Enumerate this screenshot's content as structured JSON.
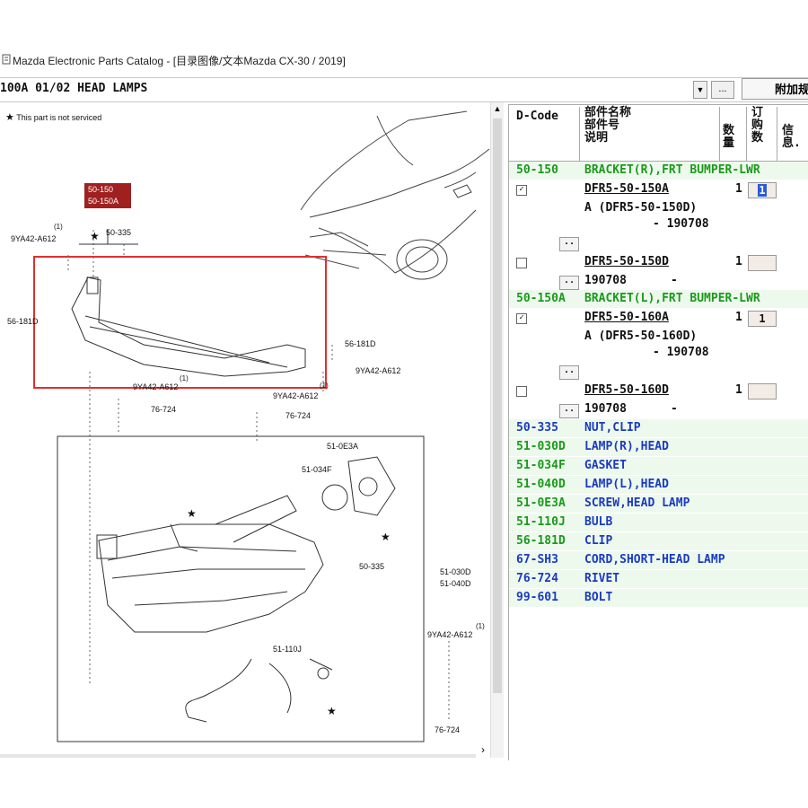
{
  "window": {
    "title": "Mazda Electronic Parts Catalog - [目录图像/文本Mazda CX-30 / 2019]"
  },
  "toolbar": {
    "section_value": "100A 01/02 HEAD LAMPS",
    "ellipsis_label": "...",
    "extra_button_label": "附加规"
  },
  "diagram": {
    "legend_note": "This part is not serviced",
    "highlight_labels": [
      "50-150",
      "50-150A"
    ],
    "callouts": {
      "c1": "9YA42-A612",
      "c1_sup": "(1)",
      "c2": "50-335",
      "c3": "56-181D",
      "c4": "56-181D",
      "c5": "9YA42-A612",
      "c6": "9YA42-A612",
      "c6_sup": "(1)",
      "c7": "9YA42-A612",
      "c7_sup": "(1)",
      "c8": "76-724",
      "c9": "76-724",
      "c10": "51-0E3A",
      "c11": "51-034F",
      "c12": "50-335",
      "c13": "51-030D",
      "c14": "51-040D",
      "c15": "9YA42-A612",
      "c15_sup": "(1)",
      "c16": "51-110J",
      "c17": "76-724"
    },
    "highlight_color": "#e03030"
  },
  "parts_panel": {
    "headers": {
      "dcode": "D-Code",
      "name_lines": [
        "部件名称",
        "部件号",
        "说明"
      ],
      "qty": "数量",
      "order": "订购数",
      "info": "信息."
    },
    "rows": [
      {
        "code": "50-150",
        "desc": "BRACKET(R),FRT BUMPER-LWR"
      },
      {
        "part_no": "DFR5-50-150A",
        "checked": "✓",
        "qty": "1",
        "order": "1"
      },
      {
        "note": "A (DFR5-50-150D)"
      },
      {
        "note": "- 190708"
      },
      {
        "part_no": "DFR5-50-150D",
        "checked": "",
        "qty": "1",
        "order": ""
      },
      {
        "note": "190708",
        "suffix": "-"
      },
      {
        "code": "50-150A",
        "desc": "BRACKET(L),FRT BUMPER-LWR"
      },
      {
        "part_no": "DFR5-50-160A",
        "checked": "✓",
        "qty": "1",
        "order": "1"
      },
      {
        "note": "A (DFR5-50-160D)"
      },
      {
        "note": "- 190708"
      },
      {
        "part_no": "DFR5-50-160D",
        "checked": "",
        "qty": "1",
        "order": ""
      },
      {
        "note": "190708",
        "suffix": "-"
      }
    ],
    "simple_rows": [
      {
        "code": "50-335",
        "desc": "NUT,CLIP"
      },
      {
        "code": "51-030D",
        "desc": "LAMP(R),HEAD"
      },
      {
        "code": "51-034F",
        "desc": "GASKET"
      },
      {
        "code": "51-040D",
        "desc": "LAMP(L),HEAD"
      },
      {
        "code": "51-0E3A",
        "desc": "SCREW,HEAD LAMP"
      },
      {
        "code": "51-110J",
        "desc": "BULB"
      },
      {
        "code": "56-181D",
        "desc": "CLIP"
      },
      {
        "code": "67-SH3",
        "desc": "CORD,SHORT-HEAD LAMP"
      },
      {
        "code": "76-724",
        "desc": "RIVET"
      },
      {
        "code": "99-601",
        "desc": "BOLT"
      }
    ],
    "dots_label": ".."
  }
}
